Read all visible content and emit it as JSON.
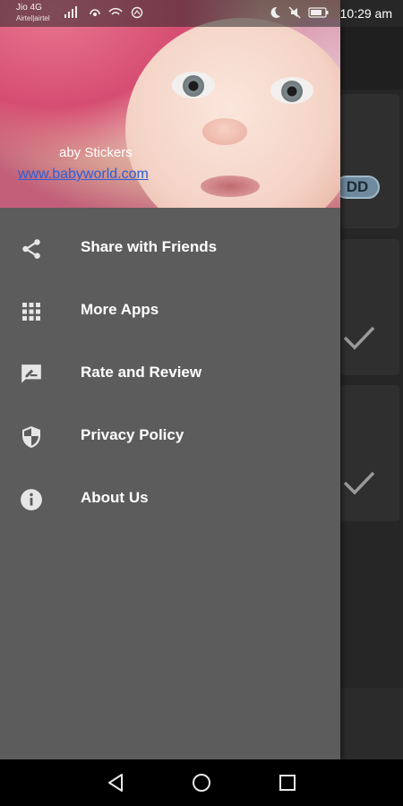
{
  "status_bar": {
    "carrier": "Jio 4G",
    "carrier_sub": "Airtel|airtel",
    "time": "10:29 am"
  },
  "drawer": {
    "header": {
      "title": "aby Stickers",
      "link": "www.babyworld.com"
    },
    "menu": [
      {
        "label": "Share with Friends",
        "icon": "share-icon"
      },
      {
        "label": "More Apps",
        "icon": "apps-grid-icon"
      },
      {
        "label": "Rate and Review",
        "icon": "rate-review-icon"
      },
      {
        "label": "Privacy Policy",
        "icon": "shield-icon"
      },
      {
        "label": "About Us",
        "icon": "info-icon"
      }
    ]
  },
  "background": {
    "pill_text": "DD"
  },
  "colors": {
    "drawer_bg": "#5c5c5c",
    "link": "#2a5fd6",
    "icon": "#e6e6e6"
  }
}
